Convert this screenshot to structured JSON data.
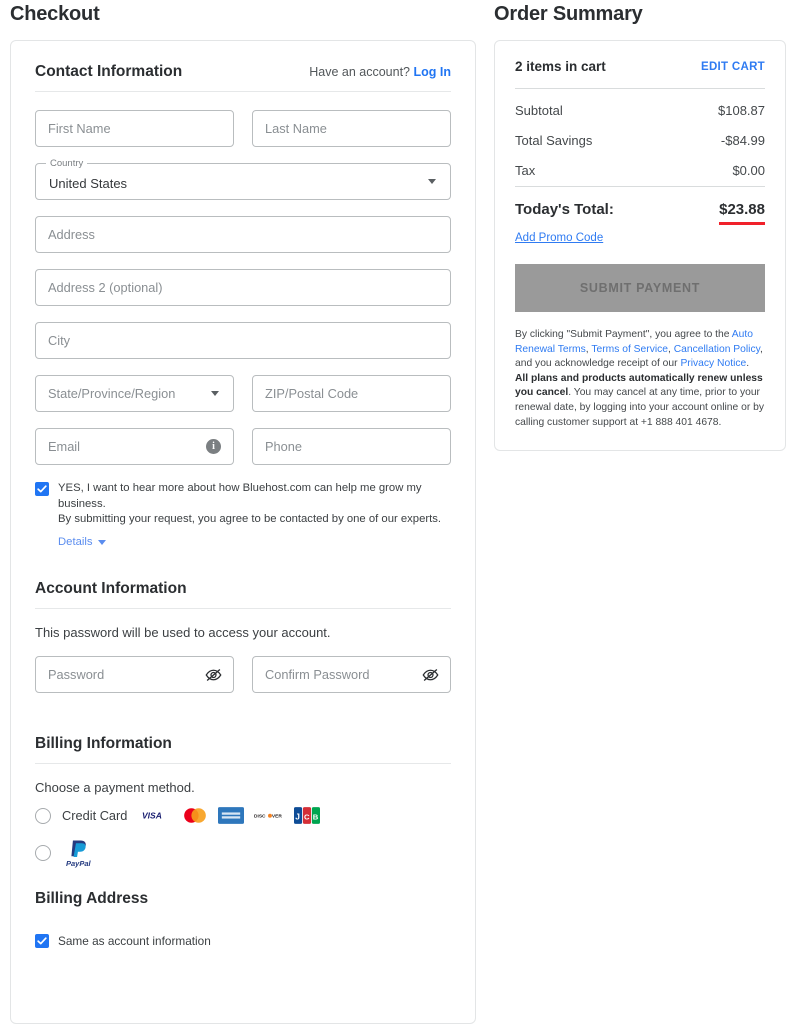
{
  "left": {
    "title": "Checkout",
    "contact": {
      "heading": "Contact Information",
      "account_prompt": "Have an account?",
      "login_link": "Log In",
      "first_name_placeholder": "First Name",
      "last_name_placeholder": "Last Name",
      "country_label": "Country",
      "country_value": "United States",
      "address_placeholder": "Address",
      "address2_placeholder": "Address 2 (optional)",
      "city_placeholder": "City",
      "state_placeholder": "State/Province/Region",
      "zip_placeholder": "ZIP/Postal Code",
      "email_placeholder": "Email",
      "phone_placeholder": "Phone",
      "optin_line1": "YES, I want to hear more about how Bluehost.com can help me grow my business.",
      "optin_line2": "By submitting your request, you agree to be contacted by one of our experts.",
      "details_label": "Details",
      "optin_checked": true
    },
    "account": {
      "heading": "Account Information",
      "hint": "This password will be used to access your account.",
      "password_placeholder": "Password",
      "confirm_placeholder": "Confirm Password"
    },
    "billing": {
      "heading": "Billing Information",
      "choose_label": "Choose a payment method.",
      "credit_card_label": "Credit Card",
      "card_brands": [
        "VISA",
        "Mastercard",
        "American Express",
        "Discover",
        "JCB"
      ],
      "paypal_label": "PayPal",
      "credit_card_selected": false,
      "paypal_selected": false
    },
    "billing_address": {
      "heading": "Billing Address",
      "same_as_account_label": "Same as account information",
      "same_as_account_checked": true
    }
  },
  "right": {
    "title": "Order Summary",
    "items_in_cart": "2 items in cart",
    "edit_cart": "EDIT CART",
    "lines": [
      {
        "label": "Subtotal",
        "value": "$108.87"
      },
      {
        "label": "Total Savings",
        "value": "-$84.99"
      },
      {
        "label": "Tax",
        "value": "$0.00"
      }
    ],
    "total_label": "Today's Total:",
    "total_value": "$23.88",
    "promo_label": "Add Promo Code",
    "submit_label": "SUBMIT PAYMENT",
    "submit_disabled": true,
    "legal": {
      "p1": "By clicking \"Submit Payment\", you agree to the ",
      "link1": "Auto Renewal Terms",
      "sep1": ", ",
      "link2": "Terms of Service",
      "sep2": ", ",
      "link3": "Cancellation Policy",
      "p2": ", and you acknowledge receipt of our ",
      "link4": "Privacy Notice",
      "p3": ". ",
      "bold": "All plans and products automatically renew unless you cancel",
      "p4": ". You may cancel at any time, prior to your renewal date, by logging into your account online or by calling customer support at +1 888 401 4678."
    }
  },
  "colors": {
    "link_blue": "#2075f3",
    "accent_red": "#f0212a",
    "disabled_gray": "#9a9a9a"
  }
}
